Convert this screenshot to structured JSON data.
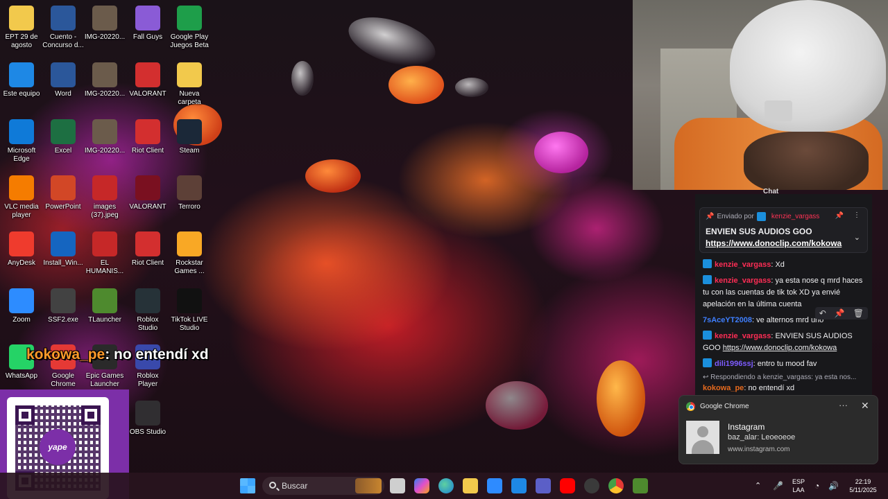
{
  "desktop": {
    "icons": [
      {
        "label": "EPT 29 de agosto",
        "icon": "folder-icon",
        "color": "#f2c94c"
      },
      {
        "label": "Cuento - Concurso d...",
        "icon": "word-doc-icon",
        "color": "#2b579a"
      },
      {
        "label": "IMG-20220...",
        "icon": "image-icon",
        "color": "#6b5b4b"
      },
      {
        "label": "Fall Guys",
        "icon": "fall-guys-icon",
        "color": "#8a5bd6"
      },
      {
        "label": "Google Play Juegos Beta",
        "icon": "google-play-games-icon",
        "color": "#1e9e4a"
      },
      {
        "label": "Este equipo",
        "icon": "computer-icon",
        "color": "#1e88e5"
      },
      {
        "label": "Word",
        "icon": "word-icon",
        "color": "#2b579a"
      },
      {
        "label": "IMG-20220...",
        "icon": "image-icon",
        "color": "#6b5b4b"
      },
      {
        "label": "VALORANT",
        "icon": "riot-icon",
        "color": "#d32f2f"
      },
      {
        "label": "Nueva carpeta",
        "icon": "folder-icon",
        "color": "#f2c94c"
      },
      {
        "label": "Microsoft Edge",
        "icon": "edge-icon",
        "color": "#0f7ad8"
      },
      {
        "label": "Excel",
        "icon": "excel-icon",
        "color": "#1d6f42"
      },
      {
        "label": "IMG-20220...",
        "icon": "image-icon",
        "color": "#6b5b4b"
      },
      {
        "label": "Riot Client",
        "icon": "riot-icon",
        "color": "#d32f2f"
      },
      {
        "label": "Steam",
        "icon": "steam-icon",
        "color": "#1b2838"
      },
      {
        "label": "VLC media player",
        "icon": "vlc-icon",
        "color": "#f57c00"
      },
      {
        "label": "PowerPoint",
        "icon": "powerpoint-icon",
        "color": "#d24726"
      },
      {
        "label": "images (37).jpeg",
        "icon": "image-icon",
        "color": "#c62828"
      },
      {
        "label": "VALORANT",
        "icon": "valorant-icon",
        "color": "#7a1020"
      },
      {
        "label": "Terroro",
        "icon": "photo-icon",
        "color": "#5d4037"
      },
      {
        "label": "AnyDesk",
        "icon": "anydesk-icon",
        "color": "#ef3b2d"
      },
      {
        "label": "Install_Win...",
        "icon": "installer-icon",
        "color": "#1565c0"
      },
      {
        "label": "EL HUMANIS...",
        "icon": "pdf-icon",
        "color": "#c62828"
      },
      {
        "label": "Riot Client",
        "icon": "riot-icon",
        "color": "#d32f2f"
      },
      {
        "label": "Rockstar Games ...",
        "icon": "rockstar-icon",
        "color": "#f9a825"
      },
      {
        "label": "Zoom",
        "icon": "zoom-icon",
        "color": "#2d8cff"
      },
      {
        "label": "SSF2.exe",
        "icon": "ssf2-icon",
        "color": "#424242"
      },
      {
        "label": "TLauncher",
        "icon": "minecraft-icon",
        "color": "#4e8a2e"
      },
      {
        "label": "Roblox Studio",
        "icon": "roblox-studio-icon",
        "color": "#263238"
      },
      {
        "label": "TikTok LIVE Studio",
        "icon": "tiktok-icon",
        "color": "#111111"
      },
      {
        "label": "WhatsApp",
        "icon": "whatsapp-icon",
        "color": "#25d366"
      },
      {
        "label": "Google Chrome",
        "icon": "chrome-icon",
        "color": "#e53935"
      },
      {
        "label": "Epic Games Launcher",
        "icon": "epic-icon",
        "color": "#2a2a2a"
      },
      {
        "label": "Roblox Player",
        "icon": "roblox-icon",
        "color": "#3949ab"
      },
      {
        "label": "OBS Studio",
        "icon": "obs-icon",
        "color": "#302e31"
      }
    ]
  },
  "chat": {
    "title": "Chat",
    "pinned": {
      "sent_by_prefix": "Enviado por",
      "sent_by_user": "kenzie_vargass",
      "title": "ENVIEN SUS AUDIOS GOO",
      "link": "https://www.donoclip.com/kokowa"
    },
    "messages": [
      {
        "user": "kenzie_vargass",
        "sep": ": ",
        "text": "Xd"
      },
      {
        "user": "kenzie_vargass",
        "sep": ": ",
        "text": "ya esta nose q mrd haces tu con las cuentas de tik tok XD ya envié apelación en la última cuenta"
      },
      {
        "user": "7sAceYT2008",
        "sep": ": ",
        "text": "ve alternos mrd uno"
      },
      {
        "user": "kenzie_vargass",
        "sep": ": ",
        "text": "ENVIEN SUS AUDIOS GOO ",
        "link": "https://www.donoclip.com/kokowa"
      },
      {
        "user": "dili1996ssj",
        "sep": ": ",
        "text": "entro tu mood fav"
      }
    ],
    "reply_context": "Respondiendo a kenzie_vargass: ya esta nos...",
    "last": {
      "user": "kokowa_pe",
      "sep": ": ",
      "text": "no entendí xd"
    }
  },
  "overlay": {
    "user": "kokowa_pe",
    "text": ": no entendí xd"
  },
  "qr": {
    "brand": "yape"
  },
  "notification": {
    "app": "Google Chrome",
    "title": "Instagram",
    "body": "baz_alar: Leoeoeoe",
    "source": "www.instagram.com",
    "more": "···",
    "close": "✕"
  },
  "taskbar": {
    "search_label": "Buscar",
    "lang": "ESP",
    "lang_sub": "LAA",
    "time": "22:19",
    "date": "5/11/2025"
  }
}
